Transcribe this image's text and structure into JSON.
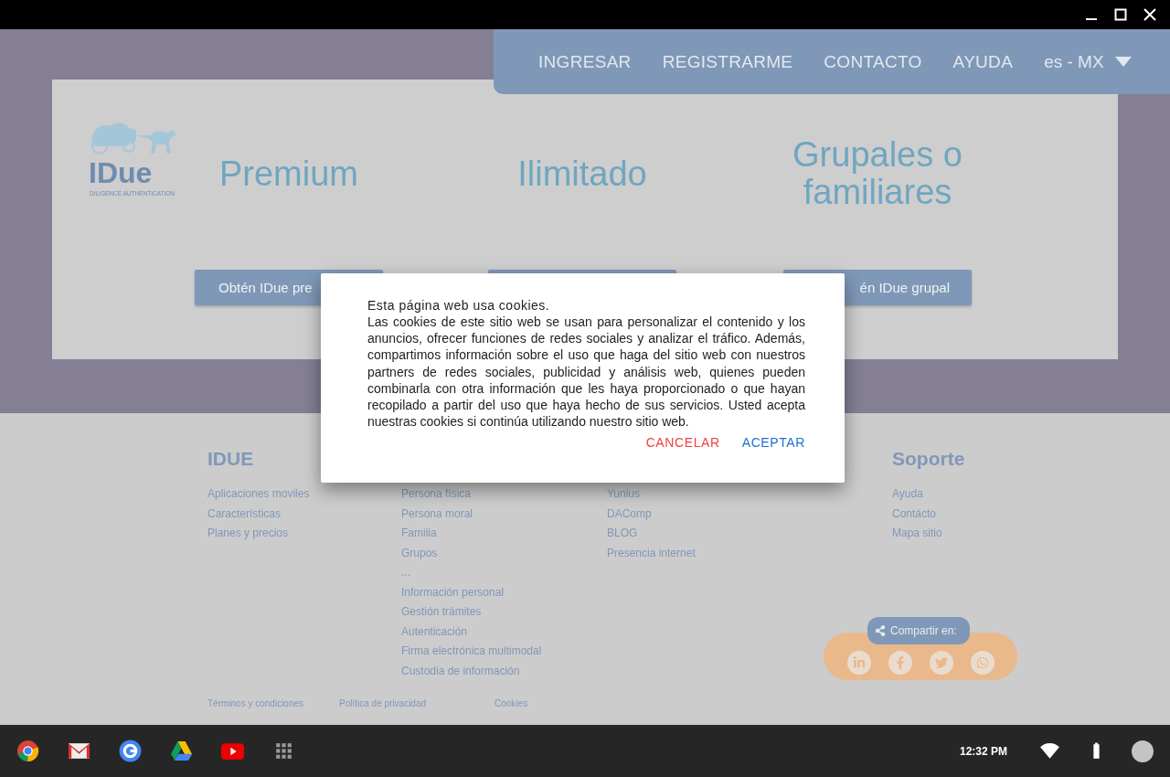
{
  "nav": {
    "items": [
      "INGRESAR",
      "REGISTRARME",
      "CONTACTO",
      "AYUDA"
    ],
    "language": "es - MX"
  },
  "logo": {
    "name": "IDue",
    "tagline": "DILIGENCE AUTHENTICATION"
  },
  "plans": [
    {
      "title": "Premium",
      "button_label": "Obtén IDue pre"
    },
    {
      "title": "Ilimitado"
    },
    {
      "title": "Grupales o familiares",
      "button_label": "én IDue grupal"
    }
  ],
  "footer": {
    "columns": [
      {
        "heading": "IDUE",
        "links": [
          "Aplicaciones moviles",
          "Características",
          "Planes y precios"
        ]
      },
      {
        "links": [
          "Persona física",
          "Persona moral",
          "Familia",
          "Grupos",
          "...",
          "Información personal",
          "Gestión trámites",
          "Autenticación",
          "Firma electrónica multimodal",
          "Custodia de información"
        ]
      },
      {
        "links": [
          "Yunius",
          "DAComp",
          "BLOG",
          "Presencia internet"
        ]
      },
      {
        "heading": "Soporte",
        "links": [
          "Ayuda",
          "Contácto",
          "Mapa sitio"
        ]
      }
    ],
    "legal": [
      "Términos y condiciones",
      "Política de privacidad",
      "Cookies"
    ],
    "share": {
      "label": "Compartir en:"
    }
  },
  "cookie_dialog": {
    "title": "Esta página web usa cookies.",
    "body": "Las cookies de este sitio web se usan para personalizar el contenido y los anuncios, ofrecer funciones de redes sociales y analizar el tráfico. Además, compartimos información sobre el uso que haga del sitio web con nuestros partners de redes sociales, publicidad y análisis web, quienes pueden combinarla con otra información que les haya proporcionado o que hayan recopilado a partir del uso que haya hecho de sus servicios. Usted acepta nuestras cookies si continúa utilizando nuestro sitio web.",
    "buttons": [
      {
        "label": "CANCELAR",
        "kind": "cancel"
      },
      {
        "label": "ACEPTAR",
        "kind": "accept"
      }
    ]
  },
  "taskbar": {
    "time": "12:32 PM"
  }
}
